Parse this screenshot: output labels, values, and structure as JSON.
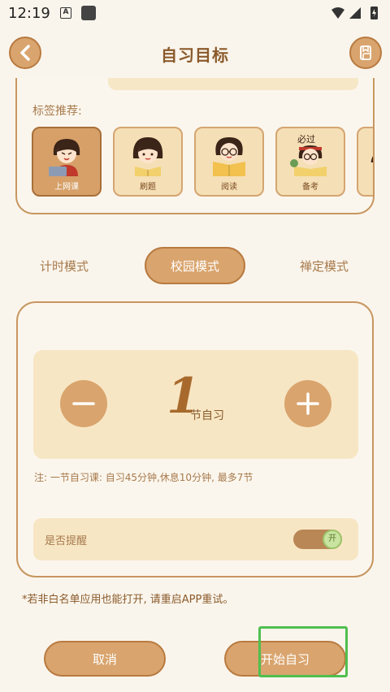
{
  "status_bar": {
    "time": "12:19",
    "a_badge": "A"
  },
  "header": {
    "title": "自习目标"
  },
  "tags": {
    "label": "标签推荐:",
    "items": [
      {
        "name": "上网课",
        "selected": true
      },
      {
        "name": "刷题",
        "selected": false
      },
      {
        "name": "阅读",
        "selected": false
      },
      {
        "name": "备考",
        "selected": false
      }
    ],
    "must_pass_text": "必过"
  },
  "modes": {
    "items": [
      "计时模式",
      "校园模式",
      "禅定模式"
    ],
    "active_index": 1
  },
  "counter": {
    "value": "1",
    "unit": "节自习",
    "note": "注: 一节自习课: 自习45分钟,休息10分钟, 最多7节"
  },
  "remind": {
    "label": "是否提醒",
    "toggle_text": "开",
    "enabled": true
  },
  "warning": "*若非白名单应用也能打开, 请重启APP重试。",
  "buttons": {
    "cancel": "取消",
    "start": "开始自习"
  },
  "colors": {
    "accent": "#d9a46d",
    "accent_dark": "#b87a40",
    "background": "#faf5ec",
    "highlight": "#4fbf4f"
  }
}
